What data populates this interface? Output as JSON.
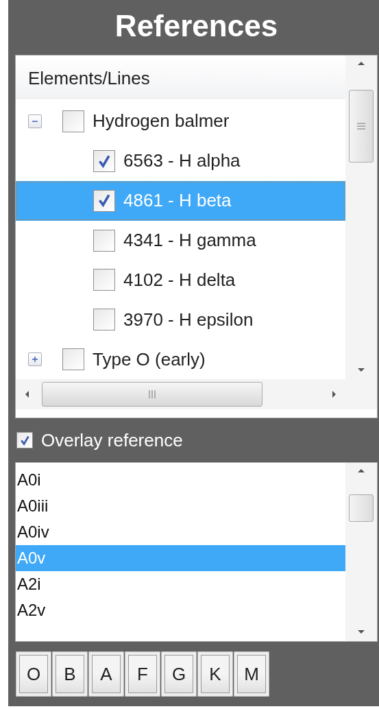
{
  "title": "References",
  "tree": {
    "header": "Elements/Lines",
    "items": [
      {
        "label": "Hydrogen balmer",
        "checked": false,
        "expanded": true,
        "selected": false,
        "children": [
          {
            "label": "6563 - H alpha",
            "checked": true,
            "selected": false
          },
          {
            "label": "4861 - H beta",
            "checked": true,
            "selected": true
          },
          {
            "label": "4341 - H gamma",
            "checked": false,
            "selected": false
          },
          {
            "label": "4102 - H delta",
            "checked": false,
            "selected": false
          },
          {
            "label": "3970 - H epsilon",
            "checked": false,
            "selected": false
          }
        ]
      },
      {
        "label": "Type O (early)",
        "checked": false,
        "expanded": false,
        "selected": false
      }
    ]
  },
  "overlay": {
    "label": "Overlay reference",
    "checked": true
  },
  "list": [
    {
      "label": "A0i",
      "selected": false
    },
    {
      "label": "A0iii",
      "selected": false
    },
    {
      "label": "A0iv",
      "selected": false
    },
    {
      "label": "A0v",
      "selected": true
    },
    {
      "label": "A2i",
      "selected": false
    },
    {
      "label": "A2v",
      "selected": false
    }
  ],
  "buttons": [
    "O",
    "B",
    "A",
    "F",
    "G",
    "K",
    "M"
  ]
}
